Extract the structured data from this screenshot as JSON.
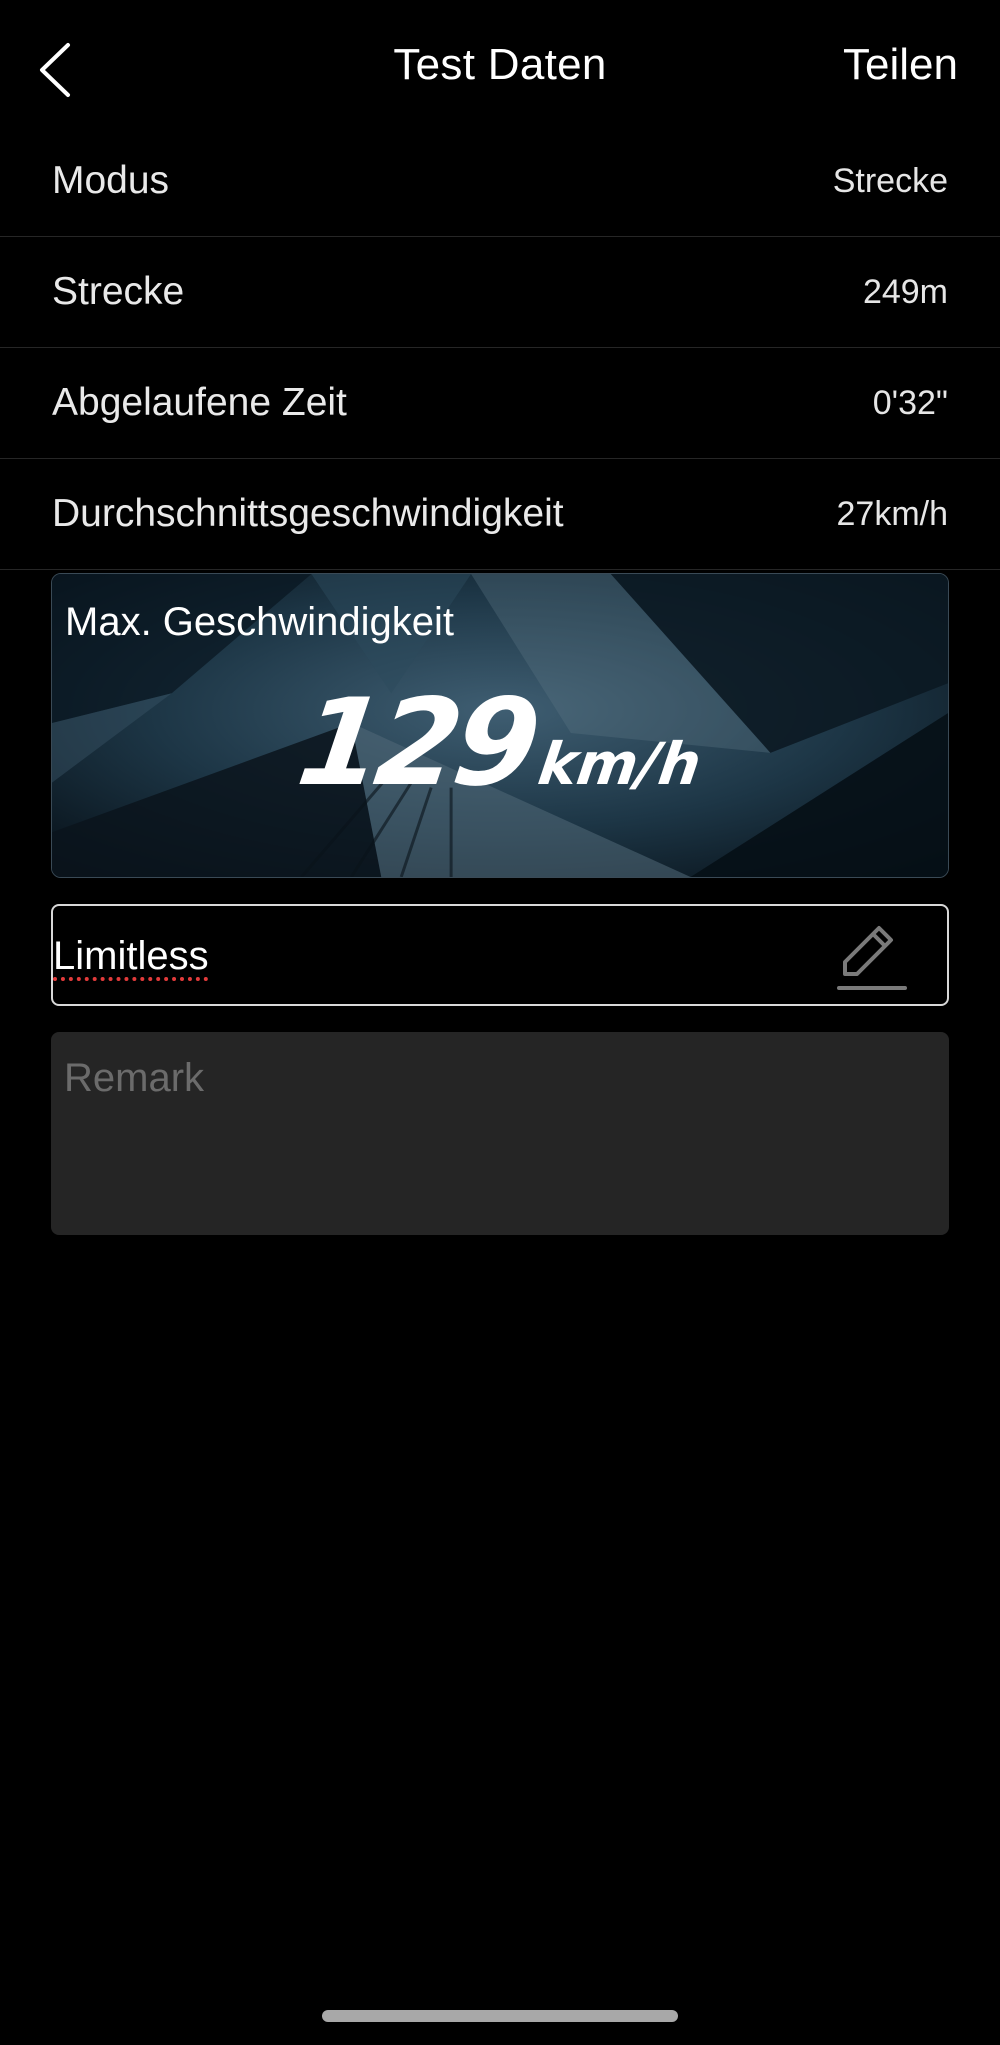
{
  "nav": {
    "title": "Test Daten",
    "share_label": "Teilen"
  },
  "info_rows": [
    {
      "label": "Modus",
      "value": "Strecke"
    },
    {
      "label": "Strecke",
      "value": "249m"
    },
    {
      "label": "Abgelaufene Zeit",
      "value": "0'32\""
    },
    {
      "label": "Durchschnittsgeschwindigkeit",
      "value": "27km/h"
    }
  ],
  "max_speed": {
    "label": "Max. Geschwindigkeit",
    "value": "129",
    "unit": "km/h"
  },
  "name_field": {
    "value": "Limitless"
  },
  "remark_field": {
    "placeholder": "Remark",
    "value": ""
  },
  "icons": {
    "back": "chevron-left-icon",
    "edit": "pencil-icon"
  },
  "colors": {
    "background": "#000000",
    "remark_background": "#252525",
    "spellcheck_underline": "#e23b3b",
    "card_background": "#0d1a24"
  }
}
